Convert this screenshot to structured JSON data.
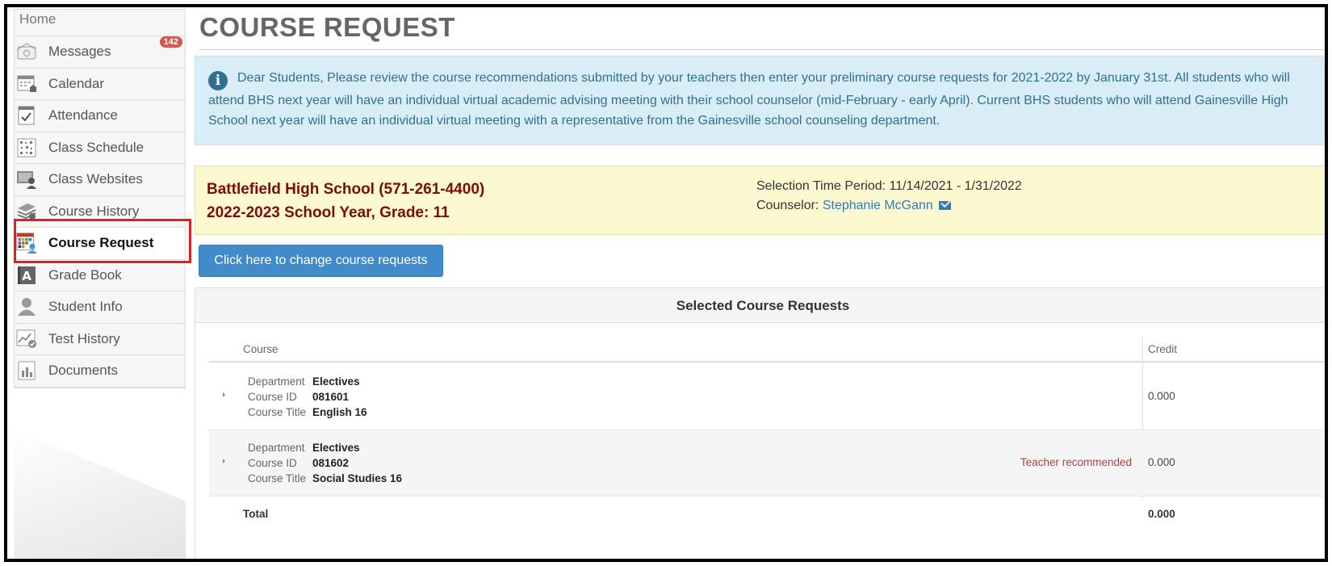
{
  "sidebar": {
    "home": "Home",
    "items": [
      {
        "label": "Messages",
        "icon": "envelope-icon",
        "badge": "142"
      },
      {
        "label": "Calendar",
        "icon": "calendar-icon"
      },
      {
        "label": "Attendance",
        "icon": "attendance-icon"
      },
      {
        "label": "Class Schedule",
        "icon": "schedule-icon"
      },
      {
        "label": "Class Websites",
        "icon": "websites-icon"
      },
      {
        "label": "Course History",
        "icon": "books-icon"
      },
      {
        "label": "Course Request",
        "icon": "course-request-icon"
      },
      {
        "label": "Grade Book",
        "icon": "gradebook-icon"
      },
      {
        "label": "Student Info",
        "icon": "student-icon"
      },
      {
        "label": "Test History",
        "icon": "test-history-icon"
      },
      {
        "label": "Documents",
        "icon": "documents-icon"
      }
    ]
  },
  "page": {
    "title": "COURSE REQUEST"
  },
  "info": {
    "text": "Dear Students, Please review the course recommendations submitted by your teachers then enter your preliminary course requests for 2021-2022 by January 31st. All students who will attend BHS next year will have an individual virtual academic advising meeting with their school counselor (mid-February - early April). Current BHS students who will attend Gainesville High School next year will have an individual virtual meeting with a representative from the Gainesville school counseling department."
  },
  "school": {
    "name": "Battlefield High School (571-261-4400)",
    "year": "2022-2023 School Year, Grade: 11",
    "period_label": "Selection Time Period: 11/14/2021 - 1/31/2022",
    "counselor_label": "Counselor:",
    "counselor_name": "Stephanie McGann"
  },
  "actions": {
    "change_button": "Click here to change course requests"
  },
  "panel": {
    "title": "Selected Course Requests",
    "col_course": "Course",
    "col_credit": "Credit",
    "lbl_department": "Department",
    "lbl_course_id": "Course ID",
    "lbl_course_title": "Course Title",
    "rows": [
      {
        "department": "Electives",
        "course_id": "081601",
        "course_title": "English 16",
        "note": "",
        "credit": "0.000"
      },
      {
        "department": "Electives",
        "course_id": "081602",
        "course_title": "Social Studies 16",
        "note": "Teacher recommended",
        "credit": "0.000"
      }
    ],
    "total_label": "Total",
    "total_credit": "0.000"
  },
  "colors": {
    "info_bg": "#d9edf7",
    "school_bg": "#fcf8d0",
    "school_text": "#7a0d0d",
    "button": "#428bca",
    "highlight_border": "#e02020",
    "badge": "#d9534f"
  }
}
